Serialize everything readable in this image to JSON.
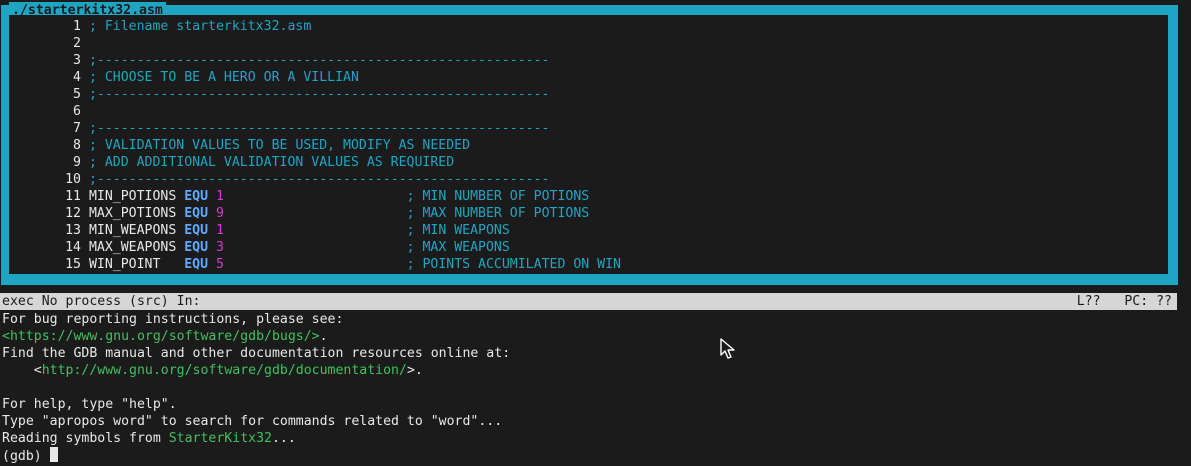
{
  "window": {
    "title": "./starterkitx32.asm"
  },
  "source": {
    "lines": [
      {
        "n": "1",
        "text": "; Filename starterkitx32.asm"
      },
      {
        "n": "2",
        "text": ""
      },
      {
        "n": "3",
        "text": ";---------------------------------------------------------"
      },
      {
        "n": "4",
        "text": "; CHOOSE TO BE A HERO OR A VILLIAN"
      },
      {
        "n": "5",
        "text": ";---------------------------------------------------------"
      },
      {
        "n": "6",
        "text": ""
      },
      {
        "n": "7",
        "text": ";---------------------------------------------------------"
      },
      {
        "n": "8",
        "text": "; VALIDATION VALUES TO BE USED, MODIFY AS NEEDED"
      },
      {
        "n": "9",
        "text": "; ADD ADDITIONAL VALIDATION VALUES AS REQUIRED"
      },
      {
        "n": "10",
        "text": ";---------------------------------------------------------"
      }
    ],
    "equ_lines": [
      {
        "n": "11",
        "name": "MIN_POTIONS ",
        "kw": "EQU",
        "val": "1",
        "comment": "; MIN NUMBER OF POTIONS"
      },
      {
        "n": "12",
        "name": "MAX_POTIONS ",
        "kw": "EQU",
        "val": "9",
        "comment": "; MAX NUMBER OF POTIONS"
      },
      {
        "n": "13",
        "name": "MIN_WEAPONS ",
        "kw": "EQU",
        "val": "1",
        "comment": "; MIN WEAPONS"
      },
      {
        "n": "14",
        "name": "MAX_WEAPONS ",
        "kw": "EQU",
        "val": "3",
        "comment": "; MAX WEAPONS"
      },
      {
        "n": "15",
        "name": "WIN_POINT   ",
        "kw": "EQU",
        "val": "5",
        "comment": "; POINTS ACCUMILATED ON WIN"
      }
    ]
  },
  "status": {
    "left": "exec No process (src) In:",
    "line": "L??",
    "pc": "PC: ??"
  },
  "console": {
    "l1": "For bug reporting instructions, please see:",
    "l2_link": "<https://www.gnu.org/software/gdb/bugs/>",
    "l2_tail": ".",
    "l3": "Find the GDB manual and other documentation resources online at:",
    "l4_pre": "    <",
    "l4_link": "http://www.gnu.org/software/gdb/documentation/",
    "l4_tail": ">.",
    "l5": "",
    "l6": "For help, type \"help\".",
    "l7": "Type \"apropos word\" to search for commands related to \"word\"...",
    "l8_pre": "Reading symbols from ",
    "l8_link": "StarterKitx32",
    "l8_tail": "...",
    "prompt": "(gdb) "
  },
  "colors": {
    "frame": "#1ea5c4",
    "background": "#1b1b1b",
    "keyword": "#5fa8ff",
    "number": "#d43bd0",
    "link": "#3ec25b"
  }
}
